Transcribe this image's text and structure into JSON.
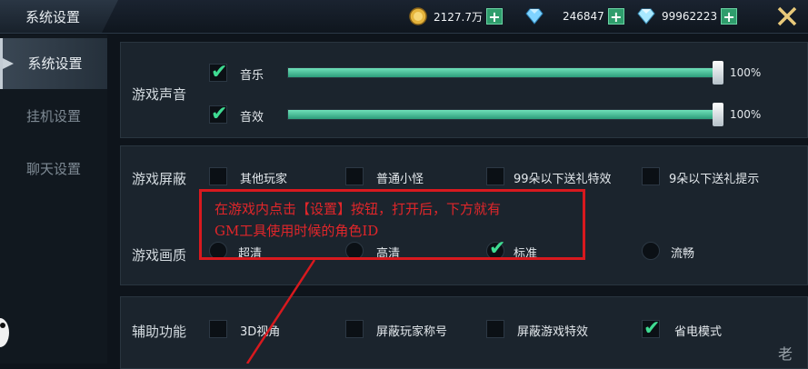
{
  "window": {
    "title": "系统设置"
  },
  "currencies": [
    {
      "icon": "gold-coin-icon",
      "amount": "2127.7万"
    },
    {
      "icon": "diamond-icon",
      "amount": "246847"
    },
    {
      "icon": "bound-diamond-icon",
      "amount": "99962223"
    }
  ],
  "sidebar": {
    "items": [
      {
        "label": "系统设置",
        "active": true
      },
      {
        "label": "挂机设置",
        "active": false
      },
      {
        "label": "聊天设置",
        "active": false
      }
    ]
  },
  "sound": {
    "label": "游戏声音",
    "music": {
      "label": "音乐",
      "checked": true,
      "value_pct": 100,
      "display": "100%"
    },
    "effects": {
      "label": "音效",
      "checked": true,
      "value_pct": 100,
      "display": "100%"
    }
  },
  "shield": {
    "label": "游戏屏蔽",
    "options": [
      {
        "label": "其他玩家",
        "checked": false
      },
      {
        "label": "普通小怪",
        "checked": false
      },
      {
        "label": "99朵以下送礼特效",
        "checked": false
      },
      {
        "label": "9朵以下送礼提示",
        "checked": false
      }
    ]
  },
  "quality": {
    "label": "游戏画质",
    "options": [
      {
        "label": "超清",
        "selected": false
      },
      {
        "label": "高清",
        "selected": false
      },
      {
        "label": "标准",
        "selected": true
      },
      {
        "label": "流畅",
        "selected": false
      }
    ]
  },
  "assist": {
    "label": "辅助功能",
    "options": [
      {
        "label": "3D视角",
        "checked": false
      },
      {
        "label": "屏蔽玩家称号",
        "checked": false
      },
      {
        "label": "屏蔽游戏特效",
        "checked": false
      },
      {
        "label": "省电模式",
        "checked": true
      }
    ]
  },
  "annotation": {
    "line1": "在游戏内点击【设置】按钮，打开后，下方就有",
    "line2": "GM工具使用时候的角色ID",
    "color": "#d8191e"
  },
  "watermark": "老",
  "colors": {
    "accent": "#3fdb92",
    "slider": "#2c9c7a",
    "plus": "#2f9d6c"
  }
}
